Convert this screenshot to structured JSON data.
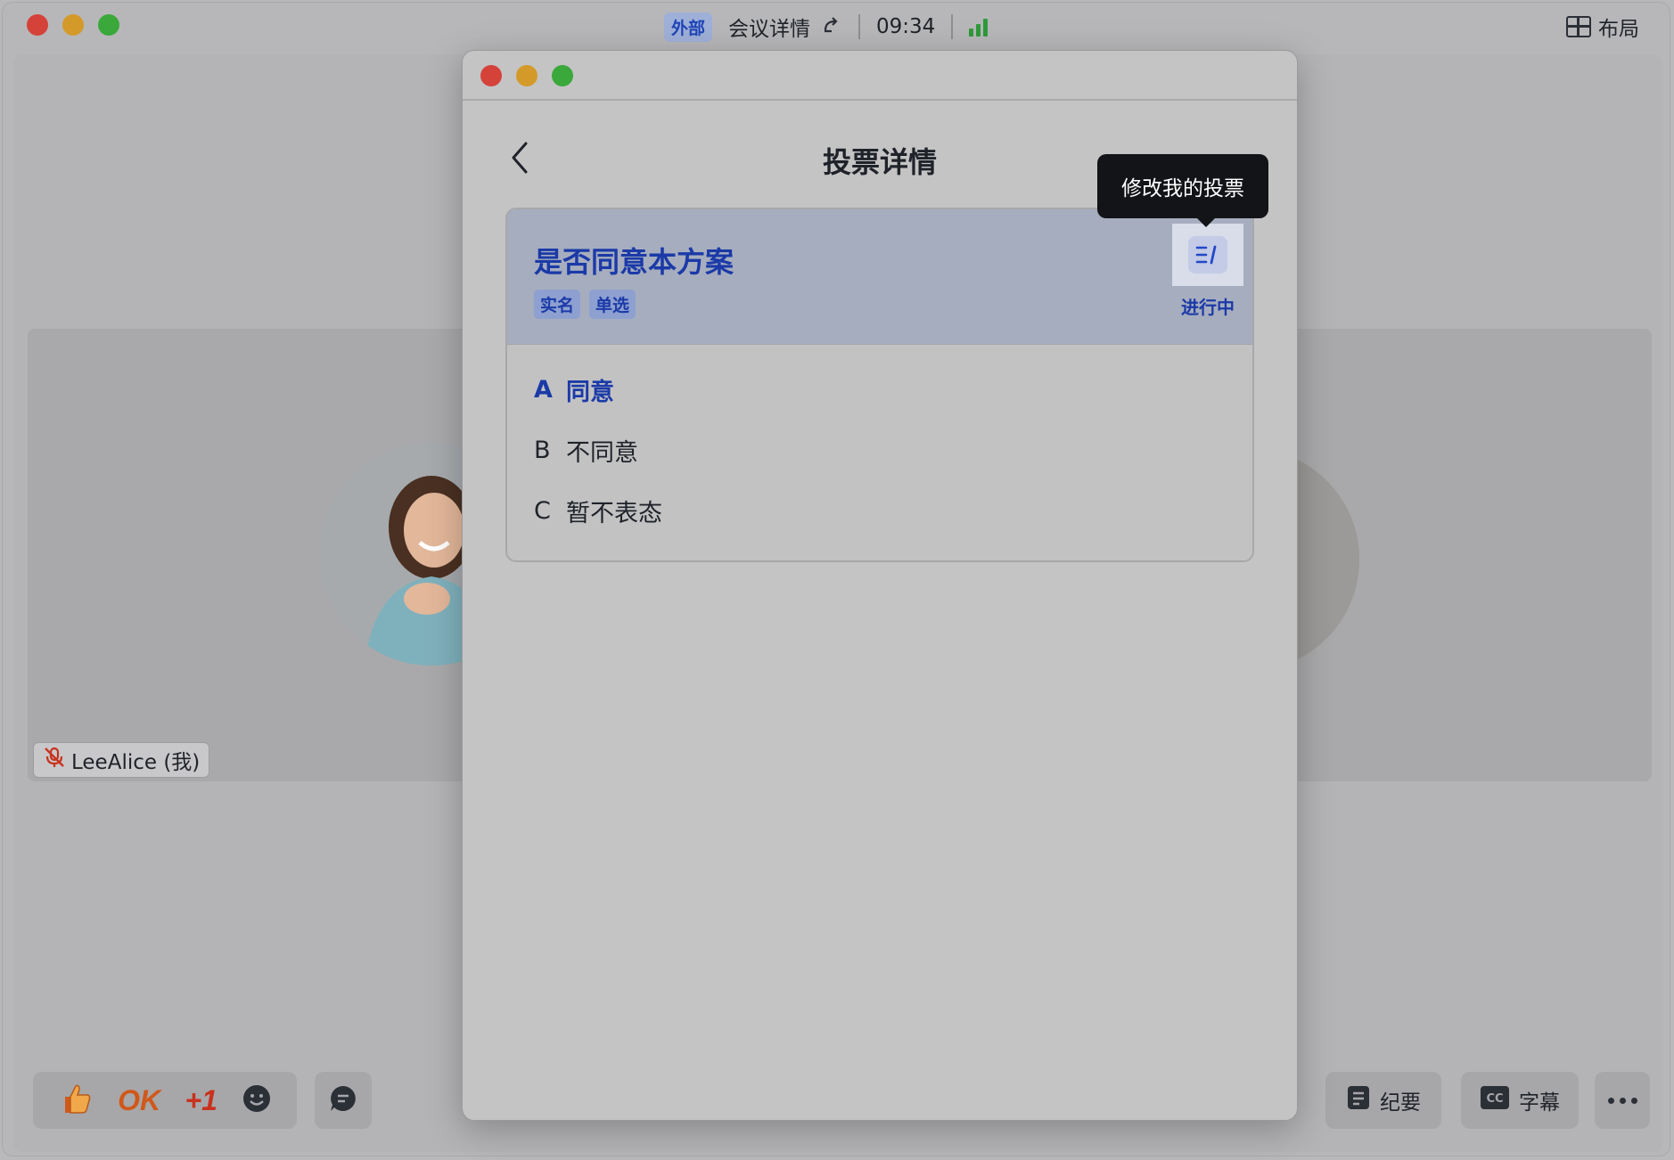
{
  "colors": {
    "accent": "#1b3aa8",
    "traffic_red": "#d5423a",
    "traffic_yellow": "#d39a2a",
    "traffic_green": "#3aa83b",
    "tooltip_bg": "#131418",
    "signal": "#2f9a3a"
  },
  "meeting": {
    "tag": "外部",
    "title": "会议详情",
    "time": "09:34",
    "layout_label": "布局"
  },
  "participant": {
    "name": "LeeAlice (我)"
  },
  "reactions": {
    "ok_label": "OK",
    "plus_label": "+1"
  },
  "toolbar": {
    "minutes_label": "纪要",
    "subtitles_label": "字幕"
  },
  "dialog": {
    "title": "投票详情",
    "tooltip": "修改我的投票",
    "poll": {
      "question": "是否同意本方案",
      "tags": [
        "实名",
        "单选"
      ],
      "status": "进行中",
      "options": [
        {
          "letter": "A",
          "text": "同意",
          "selected": true
        },
        {
          "letter": "B",
          "text": "不同意",
          "selected": false
        },
        {
          "letter": "C",
          "text": "暂不表态",
          "selected": false
        }
      ]
    }
  }
}
